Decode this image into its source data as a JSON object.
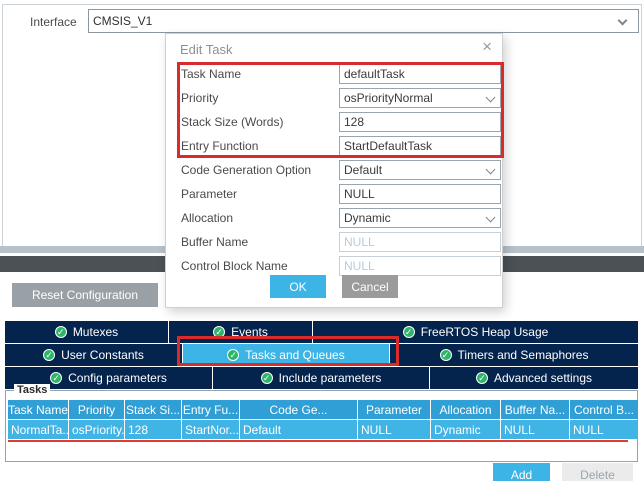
{
  "icons": {
    "check": "✓",
    "close": "×"
  },
  "colors": {
    "accent_blue": "#3cb4e6",
    "navy_tab": "#04234d",
    "table_header_blue": "#2f9fd6",
    "table_row_blue": "#41b4e6",
    "highlight_red": "#d92b2b",
    "check_green": "#2fb56a",
    "splitter_dark": "#4c5156",
    "splitter_light": "#b7c1c9"
  },
  "interface_row": {
    "label": "Interface",
    "value": "CMSIS_V1"
  },
  "dialog": {
    "title": "Edit Task",
    "fields": [
      {
        "label": "Task Name",
        "value": "defaultTask",
        "type": "text"
      },
      {
        "label": "Priority",
        "value": "osPriorityNormal",
        "type": "select"
      },
      {
        "label": "Stack Size (Words)",
        "value": "128",
        "type": "text"
      },
      {
        "label": "Entry Function",
        "value": "StartDefaultTask",
        "type": "text"
      },
      {
        "label": "Code Generation Option",
        "value": "Default",
        "type": "select"
      },
      {
        "label": "Parameter",
        "value": "NULL",
        "type": "text"
      },
      {
        "label": "Allocation",
        "value": "Dynamic",
        "type": "select"
      },
      {
        "label": "Buffer Name",
        "value": "NULL",
        "type": "text-disabled"
      },
      {
        "label": "Control Block Name",
        "value": "NULL",
        "type": "text-disabled"
      }
    ],
    "ok_label": "OK",
    "cancel_label": "Cancel"
  },
  "toolbar": {
    "reset_label": "Reset Configuration"
  },
  "tabs": {
    "rows": [
      [
        {
          "label": "Mutexes"
        },
        {
          "label": "Events"
        },
        {
          "label": "FreeRTOS Heap Usage"
        }
      ],
      [
        {
          "label": "User Constants"
        },
        {
          "label": "Tasks and Queues",
          "selected": true
        },
        {
          "label": "Timers and Semaphores"
        }
      ],
      [
        {
          "label": "Config parameters"
        },
        {
          "label": "Include parameters"
        },
        {
          "label": "Advanced settings"
        }
      ]
    ]
  },
  "tasks_panel": {
    "title": "Tasks",
    "columns": [
      "Task Name",
      "Priority",
      "Stack Si...",
      "Entry Fu...",
      "Code Ge...",
      "Parameter",
      "Allocation",
      "Buffer Na...",
      "Control B..."
    ],
    "row": [
      "NormalTa...",
      "osPriority...",
      "128",
      "StartNor...",
      "Default",
      "NULL",
      "Dynamic",
      "NULL",
      "NULL"
    ]
  },
  "footer": {
    "add_label": "Add",
    "delete_label": "Delete"
  }
}
